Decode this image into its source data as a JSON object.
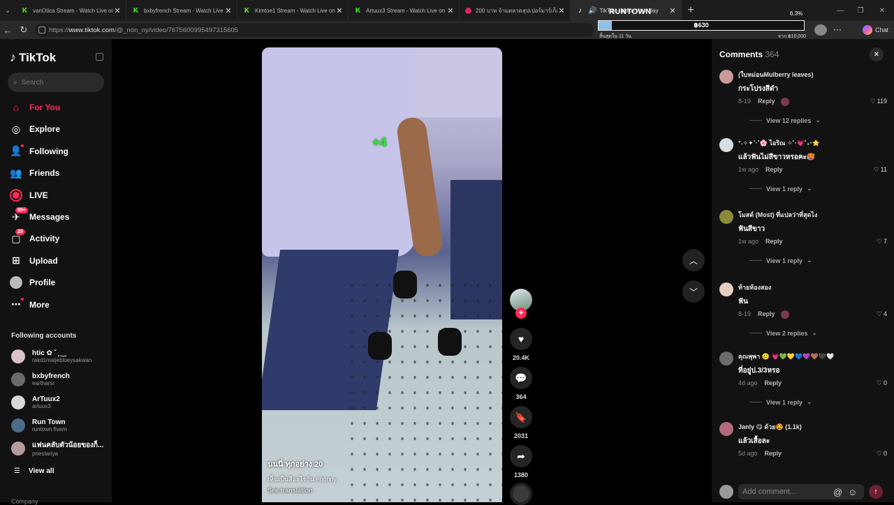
{
  "browser": {
    "tabs": [
      {
        "title": "vanOtica Stream - Watch Live on Kick",
        "favicon": "kick-icon"
      },
      {
        "title": "bxbyfrench Stream - Watch Live on Kick",
        "favicon": "kick-icon"
      },
      {
        "title": "Kimtoe1 Stream - Watch Live on Kick",
        "favicon": "kick-icon"
      },
      {
        "title": "Artuux3 Stream - Watch Live on Kick",
        "favicon": "kick-icon"
      },
      {
        "title": "200 บาท จ้ามตลาดสุปเปอร์มาร์เก็ตกิน",
        "favicon": "youtube-icon"
      },
      {
        "title": "TikTok - Make Your Day",
        "favicon": "tiktok-icon",
        "active": true
      }
    ],
    "url_prefix": "https://",
    "url_domain": "www.tiktok.com",
    "url_path": "/@_non_ny/video/7675600995497315605",
    "chat_label": "Chat"
  },
  "overlay": {
    "title": "RUNTOWN",
    "percent": "6.3%",
    "amount": "฿630",
    "progress_fraction": 0.063,
    "remaining": "สิ้นสุดใน 11 วัน",
    "goal": "จาก ฿10,000"
  },
  "sidebar": {
    "logo": "TikTok",
    "search_placeholder": "Search",
    "nav": [
      {
        "label": "For You",
        "icon": "home-icon"
      },
      {
        "label": "Explore",
        "icon": "compass-icon"
      },
      {
        "label": "Following",
        "icon": "following-icon"
      },
      {
        "label": "Friends",
        "icon": "friends-icon"
      },
      {
        "label": "LIVE",
        "icon": "live-icon"
      },
      {
        "label": "Messages",
        "icon": "messages-icon",
        "badge": "99+"
      },
      {
        "label": "Activity",
        "icon": "activity-icon",
        "badge": "29"
      },
      {
        "label": "Upload",
        "icon": "upload-icon"
      },
      {
        "label": "Profile",
        "icon": "profile-avatar"
      },
      {
        "label": "More",
        "icon": "more-icon"
      }
    ],
    "following_title": "Following accounts",
    "accounts": [
      {
        "name": "htic ✿ ˚ ̥ ‿",
        "handle": "rakd1maijebloeysakwan",
        "color": "#d9c2c8"
      },
      {
        "name": "bxbyfrench",
        "handle": "eartharsr",
        "color": "#6a6a6a"
      },
      {
        "name": "ArTuux2",
        "handle": "artuux3",
        "color": "#d8d8d8"
      },
      {
        "name": "Run Town",
        "handle": "runtown.fivem",
        "color": "#4b6b8a"
      },
      {
        "name": "แฟนคลับตัวน้อยของก็...",
        "handle": "priestariya",
        "color": "#b79aa0"
      }
    ],
    "view_all": "View all",
    "company": "Company"
  },
  "video": {
    "overlay_text": "+4",
    "author": "นนนี่ ทุกอย่าง 20",
    "caption": "เห็นเป็นสีอะไรกัน #nonny",
    "see_translation": "See translation",
    "likes": "20.4K",
    "comments": "364",
    "saves": "2031",
    "shares": "1380"
  },
  "comments": {
    "title": "Comments",
    "count": "364",
    "input_placeholder": "Add comment...",
    "items": [
      {
        "user": "(ใบหม่อนMulberry leaves)",
        "text": "กระโปรงสีดำ",
        "time": "8-19",
        "reply": "Reply",
        "likes": "119",
        "view": "View 12 replies",
        "avatar": "#c89a9a",
        "creator_liked": true
      },
      {
        "user": "°˖✧✦˚·˚🌸 ไอริณ ✧˚·💗˚₊‧⭐",
        "text": "แล้วฟันไม่สีขาวหรอคะ🥵",
        "time": "1w ago",
        "reply": "Reply",
        "likes": "11",
        "view": "View 1 reply",
        "avatar": "#d6dfe6",
        "creator_liked": false
      },
      {
        "user": "โมสต์ (Most) ที่แปลว่าที่สุดไง",
        "text": "ฟันสีขาว",
        "time": "1w ago",
        "reply": "Reply",
        "likes": "7",
        "view": "View 1 reply",
        "avatar": "#8c8a3a",
        "creator_liked": false
      },
      {
        "user": "ท้ายห้องสอง",
        "text": "ฟัน",
        "time": "8-19",
        "reply": "Reply",
        "likes": "4",
        "view": "View 2 replies",
        "avatar": "#e6cfc2",
        "creator_liked": true
      },
      {
        "user": "คุณพุพา 🥲 💗💚💛💙💜🤎🖤🤍",
        "text": "ที่อยู่ป.3/3หรอ",
        "time": "4d ago",
        "reply": "Reply",
        "likes": "0",
        "view": "View 1 reply",
        "avatar": "#6d6a70",
        "creator_liked": false
      },
      {
        "user": "Janly 😋 ด้วย🤩 (1.1k)",
        "text": "แล้วเสื้อละ",
        "time": "5d ago",
        "reply": "Reply",
        "likes": "0",
        "view": "",
        "avatar": "#b06a7a",
        "creator_liked": false
      }
    ]
  }
}
